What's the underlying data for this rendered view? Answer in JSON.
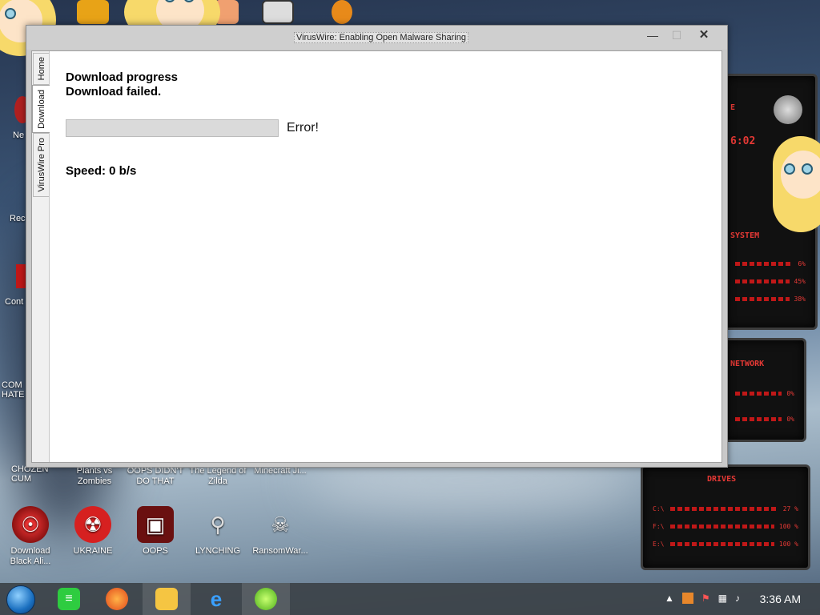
{
  "window": {
    "title": "VirusWire: Enabling Open Malware Sharing",
    "minimize": "—",
    "maximize": "☐",
    "close": "✕"
  },
  "tabs": [
    {
      "label": "Home"
    },
    {
      "label": "Download"
    },
    {
      "label": "VirusWire Pro"
    }
  ],
  "download": {
    "heading": "Download progress",
    "status": "Download failed.",
    "progress": 0,
    "progress_status": "Error!",
    "speed": "Speed: 0 b/s"
  },
  "desktop_icons": [
    {
      "label": "Download Black Ali...",
      "icon": "alien-icon"
    },
    {
      "label": "UKRAINE",
      "icon": "radiation-icon"
    },
    {
      "label": "OOPS",
      "icon": "oops-icon"
    },
    {
      "label": "LYNCHING",
      "icon": "noose-icon"
    },
    {
      "label": "RansomWar...",
      "icon": "skull-icon"
    }
  ],
  "desktop_icons_partial": [
    {
      "label": "Plants vs Zombies"
    },
    {
      "label": "OOPS DIDN'T DO THAT"
    },
    {
      "label": "The Legend of Zilda"
    },
    {
      "label": "Minecraft Ji..."
    }
  ],
  "left_edge_labels": [
    "Ne",
    "Rec",
    "Cont",
    "COM HATE",
    "CHOZEN CUM"
  ],
  "gadget": {
    "section_system": "SYSTEM",
    "time": "6:02",
    "values_system": [
      "6%",
      "45%",
      "38%"
    ],
    "section_network": "NETWORK",
    "values_network": [
      "0%",
      "0%"
    ],
    "section_drives": "DRIVES",
    "drives": [
      {
        "label": "C:\\",
        "value": "27 %"
      },
      {
        "label": "F:\\",
        "value": "100 %"
      },
      {
        "label": "E:\\",
        "value": "100 %"
      }
    ]
  },
  "taskbar": {
    "apps": [
      "start-orb-icon",
      "notes-icon",
      "firefox-icon",
      "file-explorer-icon",
      "internet-explorer-icon",
      "limewire-icon"
    ],
    "clock": "3:36 AM"
  }
}
